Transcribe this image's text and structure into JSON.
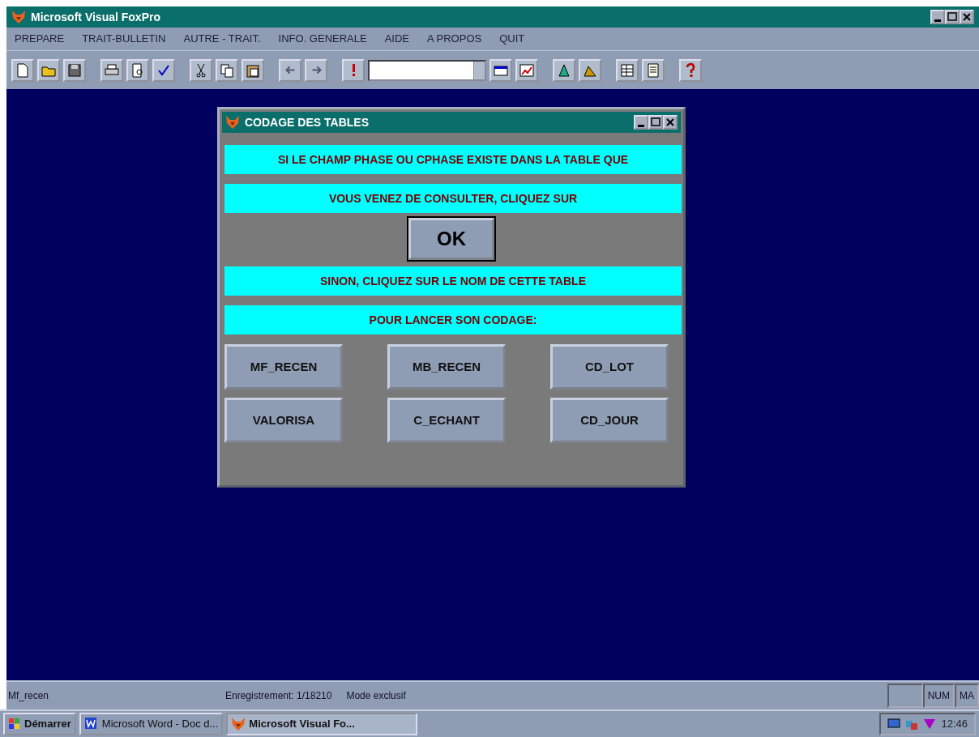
{
  "window": {
    "title": "Microsoft Visual FoxPro"
  },
  "menu": [
    "PREPARE",
    "TRAIT-BULLETIN",
    "AUTRE - TRAIT.",
    "INFO. GENERALE",
    "AIDE",
    "A PROPOS",
    "QUIT"
  ],
  "dialog": {
    "title": "CODAGE DES TABLES",
    "lines_top": [
      "SI LE CHAMP PHASE OU CPHASE EXISTE DANS LA TABLE QUE",
      "VOUS VENEZ DE CONSULTER, CLIQUEZ SUR"
    ],
    "ok_button": "OK",
    "lines_bottom": [
      "SINON, CLIQUEZ SUR LE NOM DE CETTE TABLE",
      "POUR LANCER SON CODAGE:"
    ],
    "table_buttons": [
      "MF_RECEN",
      "MB_RECEN",
      "CD_LOT",
      "VALORISA",
      "C_ECHANT",
      "CD_JOUR"
    ]
  },
  "status_bar": {
    "table": "Mf_recen",
    "record": "Enregistrement: 1/18210",
    "mode": "Mode exclusif",
    "indicators": [
      "NUM",
      "MA"
    ]
  },
  "taskbar": {
    "start": "Démarrer",
    "tasks": [
      {
        "label": "Microsoft Word - Doc d...",
        "selected": false,
        "kind": "word"
      },
      {
        "label": "Microsoft Visual Fo...",
        "selected": true,
        "kind": "fox"
      }
    ],
    "clock": "12:46"
  }
}
